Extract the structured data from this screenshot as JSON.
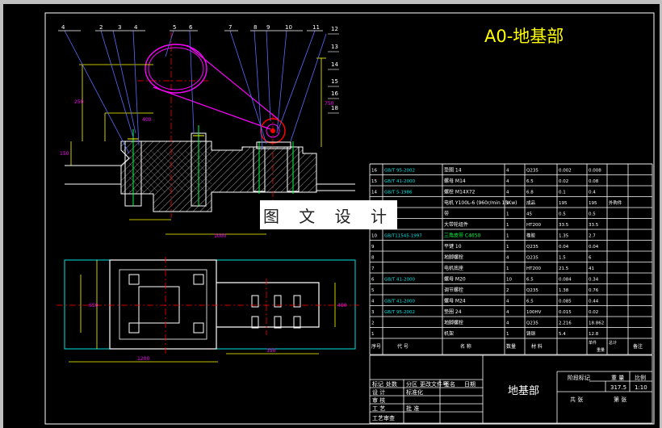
{
  "drawing": {
    "title": "A0-地基部",
    "callouts": [
      "4",
      "2",
      "3",
      "4",
      "5",
      "6",
      "7",
      "8",
      "9",
      "10",
      "11",
      "12",
      "13",
      "14",
      "15",
      "16",
      "18"
    ],
    "dims": [
      "250",
      "750",
      "1000",
      "650",
      "350",
      "1200",
      "400",
      "150"
    ],
    "watermark": "图 文 设 计"
  },
  "bom": {
    "rows": [
      {
        "no": "16",
        "code": "GB/T 95-2002",
        "name": "垫圈 14",
        "qty": "4",
        "material": "Q235",
        "unit": "0.002",
        "total": "0.008",
        "note": ""
      },
      {
        "no": "15",
        "code": "GB/T 41-2000",
        "name": "螺母 M14",
        "qty": "4",
        "material": "6.5",
        "unit": "0.02",
        "total": "0.08",
        "note": ""
      },
      {
        "no": "14",
        "code": "GB/T 5-1986",
        "name": "螺栓 M14X72",
        "qty": "4",
        "material": "6.8",
        "unit": "0.1",
        "total": "0.4",
        "note": ""
      },
      {
        "no": "13",
        "code": "",
        "name": "电机 Y100L-6 (960r/min 15Kw)",
        "qty": "1",
        "material": "成品",
        "unit": "195",
        "total": "195",
        "note": "外购件"
      },
      {
        "no": "12",
        "code": "",
        "name": "带",
        "qty": "1",
        "material": "45",
        "unit": "0.5",
        "total": "0.5",
        "note": ""
      },
      {
        "no": "11",
        "code": "",
        "name": "大带轮组件",
        "qty": "1",
        "material": "HT200",
        "unit": "33.5",
        "total": "33.5",
        "note": ""
      },
      {
        "no": "10",
        "code": "GB/T11545-1997",
        "name": "三角皮带 C4650",
        "qty": "1",
        "material": "橡胶",
        "unit": "1.35",
        "total": "2.7",
        "note": ""
      },
      {
        "no": "9",
        "code": "",
        "name": "平键 10",
        "qty": "1",
        "material": "Q235",
        "unit": "0.04",
        "total": "0.04",
        "note": ""
      },
      {
        "no": "8",
        "code": "",
        "name": "地脚螺栓",
        "qty": "4",
        "material": "Q235",
        "unit": "1.5",
        "total": "6",
        "note": ""
      },
      {
        "no": "7",
        "code": "",
        "name": "电机底座",
        "qty": "1",
        "material": "HT200",
        "unit": "21.5",
        "total": "41",
        "note": ""
      },
      {
        "no": "6",
        "code": "GB/T 41-2000",
        "name": "螺母 M20",
        "qty": "10",
        "material": "6.5",
        "unit": "0.084",
        "total": "0.34",
        "note": ""
      },
      {
        "no": "5",
        "code": "",
        "name": "调节螺栓",
        "qty": "2",
        "material": "Q235",
        "unit": "1.38",
        "total": "0.76",
        "note": ""
      },
      {
        "no": "4",
        "code": "GB/T 41-2000",
        "name": "螺母 M24",
        "qty": "4",
        "material": "6.5",
        "unit": "0.085",
        "total": "0.44",
        "note": ""
      },
      {
        "no": "3",
        "code": "GB/T 95-2002",
        "name": "垫圈 24",
        "qty": "4",
        "material": "100HV",
        "unit": "0.015",
        "total": "0.02",
        "note": ""
      },
      {
        "no": "2",
        "code": "",
        "name": "地脚螺栓",
        "qty": "4",
        "material": "Q235",
        "unit": "2.216",
        "total": "18.862",
        "note": ""
      },
      {
        "no": "1",
        "code": "",
        "name": "机架",
        "qty": "1",
        "material": "铸钢",
        "unit": "5.4",
        "total": "12.8",
        "note": ""
      }
    ],
    "header": {
      "no": "序号",
      "code": "代 号",
      "name": "名 称",
      "qty": "数量",
      "material": "材 料",
      "unit": "单件",
      "total": "总计",
      "weight": "重量",
      "note": "备注"
    }
  },
  "titleblock": {
    "part_name": "地基部",
    "left_labels": [
      "标记",
      "处数",
      "分区",
      "更改文件号",
      "签名",
      "日期",
      "设 计",
      "标准化",
      "审 核",
      "工 艺",
      "批 准",
      "工艺审查"
    ],
    "stage_label": "阶段标记",
    "weight_label": "重 量",
    "scale_label": "比例",
    "weight_value": "317.5",
    "scale_value": "1:10",
    "sheets_label": "共 张",
    "sheet_label": "第 张"
  },
  "colors": {
    "background": "#000000",
    "outline": "#ffffff",
    "yellow": "#ffff00",
    "red": "#ff0000",
    "blue": "#5a6cff",
    "cyan": "#00e0e0",
    "magenta": "#ff00ff",
    "green": "#00ff40",
    "frame": "#c0c0c0"
  }
}
